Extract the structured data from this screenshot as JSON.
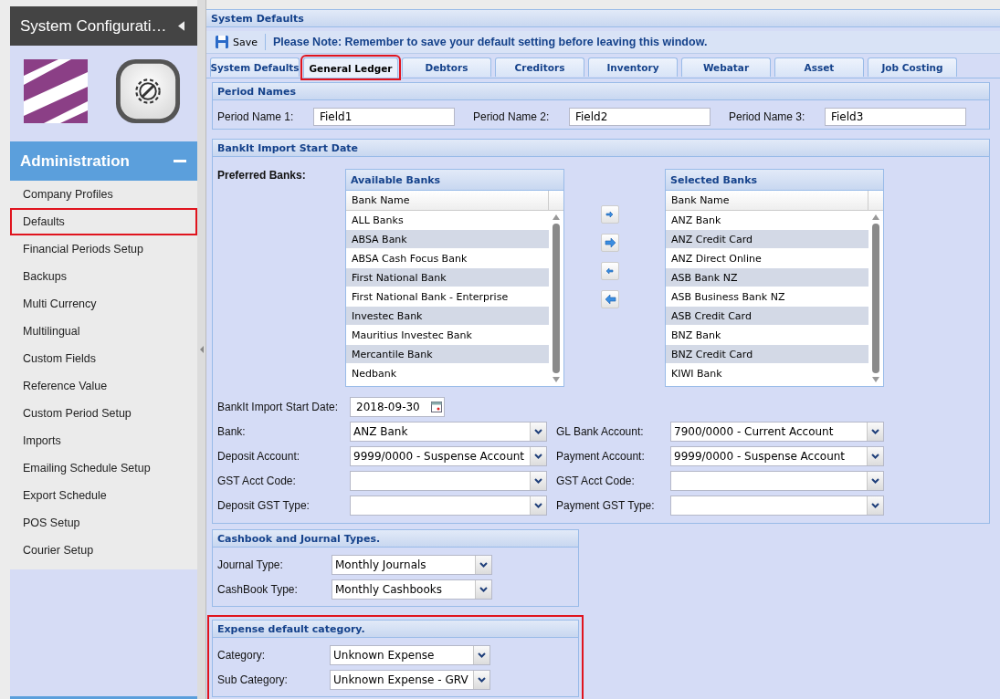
{
  "sidebar": {
    "title": "System Configurati…",
    "section": {
      "title": "Administration",
      "expanded": true
    },
    "items": [
      {
        "label": "Company Profiles",
        "highlighted": false
      },
      {
        "label": "Defaults",
        "highlighted": true
      },
      {
        "label": "Financial Periods Setup",
        "highlighted": false
      },
      {
        "label": "Backups",
        "highlighted": false
      },
      {
        "label": "Multi Currency",
        "highlighted": false
      },
      {
        "label": "Multilingual",
        "highlighted": false
      },
      {
        "label": "Custom Fields",
        "highlighted": false
      },
      {
        "label": "Reference Value",
        "highlighted": false
      },
      {
        "label": "Custom Period Setup",
        "highlighted": false
      },
      {
        "label": "Imports",
        "highlighted": false
      },
      {
        "label": "Emailing Schedule Setup",
        "highlighted": false
      },
      {
        "label": "Export Schedule",
        "highlighted": false
      },
      {
        "label": "POS Setup",
        "highlighted": false
      },
      {
        "label": "Courier Setup",
        "highlighted": false
      }
    ]
  },
  "panel": {
    "title": "System Defaults",
    "toolbar": {
      "save": "Save",
      "note": "Please Note: Remember to save your default setting before leaving this window."
    },
    "tabs": [
      {
        "label": "System Defaults",
        "selected": false,
        "highlighted": false
      },
      {
        "label": "General Ledger",
        "selected": true,
        "highlighted": true
      },
      {
        "label": "Debtors",
        "selected": false,
        "highlighted": false
      },
      {
        "label": "Creditors",
        "selected": false,
        "highlighted": false
      },
      {
        "label": "Inventory",
        "selected": false,
        "highlighted": false
      },
      {
        "label": "Webatar",
        "selected": false,
        "highlighted": false
      },
      {
        "label": "Asset",
        "selected": false,
        "highlighted": false
      },
      {
        "label": "Job Costing",
        "selected": false,
        "highlighted": false
      }
    ],
    "period_names": {
      "title": "Period Names",
      "fields": [
        {
          "label": "Period Name 1:",
          "value": "Field1"
        },
        {
          "label": "Period Name 2:",
          "value": "Field2"
        },
        {
          "label": "Period Name 3:",
          "value": "Field3"
        }
      ]
    },
    "bankit": {
      "title": "BankIt Import Start Date",
      "preferred_label": "Preferred Banks:",
      "available": {
        "title": "Available Banks",
        "column": "Bank Name",
        "rows": [
          "ALL Banks",
          "ABSA Bank",
          "ABSA Cash Focus Bank",
          "First National Bank",
          "First National Bank - Enterprise",
          "Investec Bank",
          "Mauritius Investec Bank",
          "Mercantile Bank",
          "Nedbank"
        ]
      },
      "chosen": {
        "title": "Selected Banks",
        "column": "Bank Name",
        "rows": [
          "ANZ Bank",
          "ANZ Credit Card",
          "ANZ Direct Online",
          "ASB Bank NZ",
          "ASB Business Bank NZ",
          "ASB Credit Card",
          "BNZ Bank",
          "BNZ Credit Card",
          "KIWI Bank"
        ]
      },
      "start_date": {
        "label": "BankIt Import Start Date:",
        "value": "2018-09-30"
      },
      "fields": [
        {
          "label": "Bank:",
          "value": "ANZ Bank"
        },
        {
          "label": "GL Bank Account:",
          "value": "7900/0000 - Current Account"
        },
        {
          "label": "Deposit Account:",
          "value": "9999/0000 - Suspense Account"
        },
        {
          "label": "Payment Account:",
          "value": "9999/0000 - Suspense Account"
        },
        {
          "label": "GST Acct Code:"
        },
        {
          "label": "GST Acct Code:"
        },
        {
          "label": "Deposit GST Type:"
        },
        {
          "label": "Payment GST Type:"
        }
      ]
    },
    "cashbook": {
      "title": "Cashbook and Journal Types.",
      "highlighted": false,
      "fields": [
        {
          "label": "Journal Type:",
          "value": "Monthly Journals"
        },
        {
          "label": "CashBook Type:",
          "value": "Monthly Cashbooks"
        }
      ]
    },
    "expense": {
      "title": "Expense default category.",
      "highlighted": true,
      "fields": [
        {
          "label": "Category:",
          "value": "Unknown Expense"
        },
        {
          "label": "Sub Category:",
          "value": "Unknown Expense - GRV"
        }
      ]
    }
  }
}
